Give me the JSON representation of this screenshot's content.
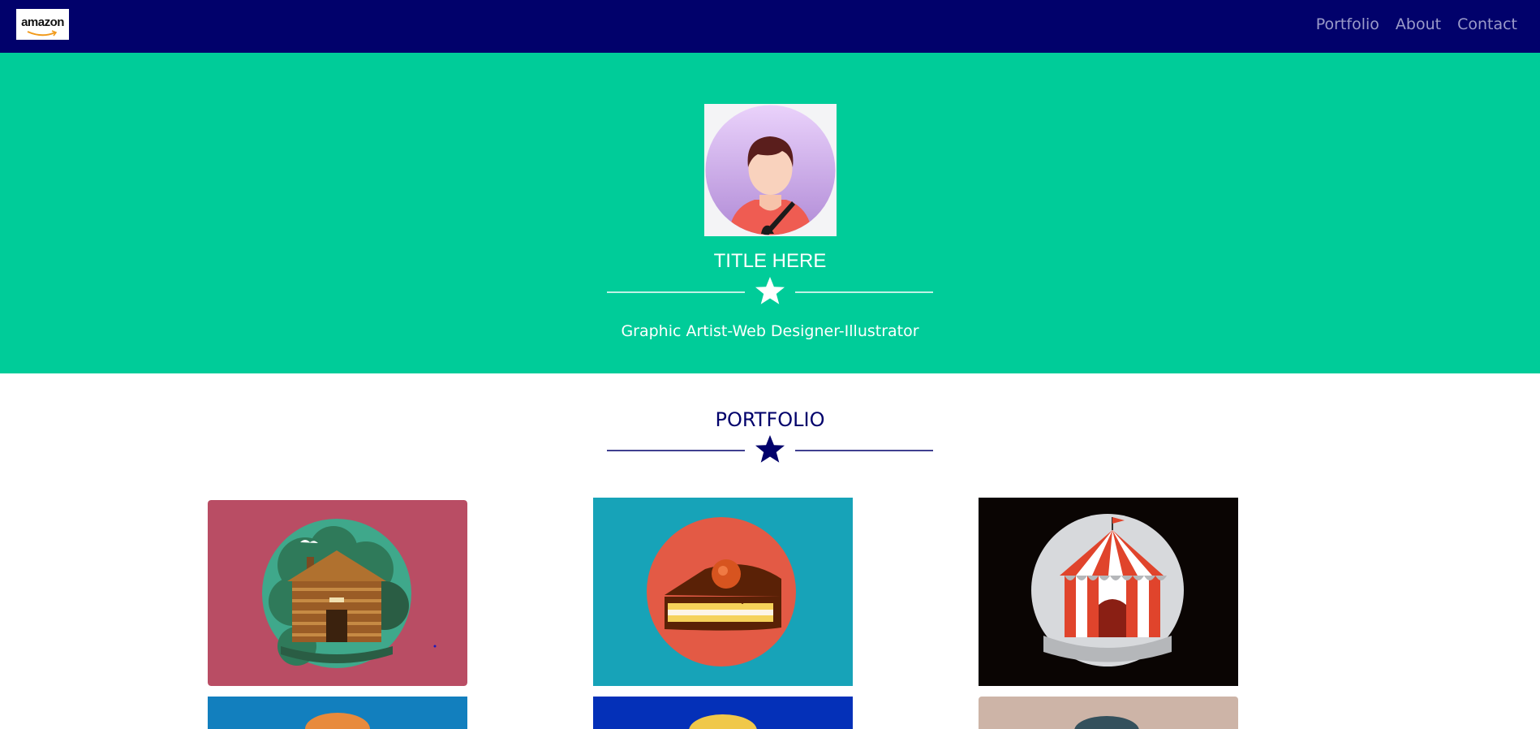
{
  "navbar": {
    "logo_text": "amazon",
    "links": [
      {
        "label": "Portfolio"
      },
      {
        "label": "About"
      },
      {
        "label": "Contact"
      }
    ],
    "background": "#01016b"
  },
  "hero": {
    "title": "TITLE HERE",
    "subtitle": "Graphic Artist-Web Designer-Illustrator",
    "background": "#00cc99",
    "divider_icon": "star-icon"
  },
  "portfolio": {
    "title": "PORTFOLIO",
    "divider_icon": "star-icon",
    "items": [
      {
        "name": "log-cabin",
        "background": "#b94d64"
      },
      {
        "name": "cake-slice",
        "background": "#17a3b8"
      },
      {
        "name": "circus-tent",
        "background": "#0a0503"
      },
      {
        "name": "item-4",
        "background": "#127fbe"
      },
      {
        "name": "item-5",
        "background": "#0430b8"
      },
      {
        "name": "item-6",
        "background": "#cdb4a7"
      }
    ]
  }
}
